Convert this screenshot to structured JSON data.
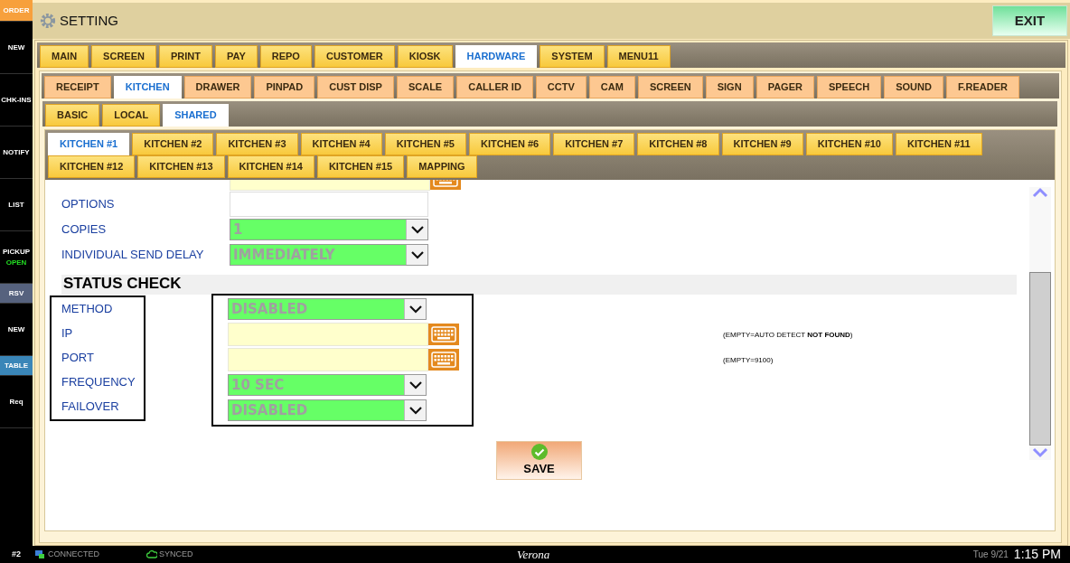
{
  "sidebar": {
    "items": [
      {
        "label": "ORDER",
        "color": "#f7a03c"
      },
      {
        "label": "NEW"
      },
      {
        "label": "CHK-INS"
      },
      {
        "label": "NOTIFY"
      },
      {
        "label": "LIST"
      },
      {
        "label": "PICKUP",
        "sub": "OPEN"
      },
      {
        "label": "RSV",
        "color": "#56627e"
      },
      {
        "label": "NEW"
      },
      {
        "label": "TABLE",
        "color": "#3a86b8"
      },
      {
        "label": "Req"
      }
    ]
  },
  "header": {
    "title": "SETTING",
    "exit": "EXIT"
  },
  "tabs": [
    {
      "label": "MAIN",
      "selected": false
    },
    {
      "label": "SCREEN",
      "selected": false
    },
    {
      "label": "PRINT",
      "selected": false
    },
    {
      "label": "PAY",
      "selected": false
    },
    {
      "label": "REPO",
      "selected": false
    },
    {
      "label": "CUSTOMER",
      "selected": false
    },
    {
      "label": "KIOSK",
      "selected": false
    },
    {
      "label": "HARDWARE",
      "selected": true
    },
    {
      "label": "SYSTEM",
      "selected": false
    },
    {
      "label": "MENU11",
      "selected": false
    }
  ],
  "hardware_tabs": [
    {
      "label": "RECEIPT",
      "selected": false
    },
    {
      "label": "KITCHEN",
      "selected": true
    },
    {
      "label": "DRAWER",
      "selected": false
    },
    {
      "label": "PINPAD",
      "selected": false
    },
    {
      "label": "CUST DISP",
      "selected": false
    },
    {
      "label": "SCALE",
      "selected": false
    },
    {
      "label": "CALLER ID",
      "selected": false
    },
    {
      "label": "CCTV",
      "selected": false
    },
    {
      "label": "CAM",
      "selected": false
    },
    {
      "label": "SCREEN",
      "selected": false
    },
    {
      "label": "SIGN",
      "selected": false
    },
    {
      "label": "PAGER",
      "selected": false
    },
    {
      "label": "SPEECH",
      "selected": false
    },
    {
      "label": "SOUND",
      "selected": false
    },
    {
      "label": "F.READER",
      "selected": false
    }
  ],
  "kitchen_tabs": [
    {
      "label": "BASIC",
      "selected": false
    },
    {
      "label": "LOCAL",
      "selected": false
    },
    {
      "label": "SHARED",
      "selected": true
    }
  ],
  "printer_tabs": [
    {
      "label": "KITCHEN #1",
      "selected": true
    },
    {
      "label": "KITCHEN #2",
      "selected": false
    },
    {
      "label": "KITCHEN #3",
      "selected": false
    },
    {
      "label": "KITCHEN #4",
      "selected": false
    },
    {
      "label": "KITCHEN #5",
      "selected": false
    },
    {
      "label": "KITCHEN #6",
      "selected": false
    },
    {
      "label": "KITCHEN #7",
      "selected": false
    },
    {
      "label": "KITCHEN #8",
      "selected": false
    },
    {
      "label": "KITCHEN #9",
      "selected": false
    },
    {
      "label": "KITCHEN #10",
      "selected": false
    },
    {
      "label": "KITCHEN #11",
      "selected": false
    },
    {
      "label": "KITCHEN #12",
      "selected": false
    },
    {
      "label": "KITCHEN #13",
      "selected": false
    },
    {
      "label": "KITCHEN #14",
      "selected": false
    },
    {
      "label": "KITCHEN #15",
      "selected": false
    },
    {
      "label": "MAPPING",
      "selected": false
    }
  ],
  "fields": [
    {
      "kind": "keyboard"
    },
    {
      "kind": "text",
      "label": "OPTIONS"
    },
    {
      "kind": "select",
      "label": "COPIES",
      "value": "1"
    },
    {
      "kind": "select",
      "label": "INDIVIDUAL SEND DELAY",
      "value": "IMMEDIATELY"
    }
  ],
  "status_check": {
    "title": "STATUS CHECK",
    "fields": [
      {
        "kind": "select",
        "label": "METHOD",
        "value": "DISABLED"
      },
      {
        "kind": "keyboard",
        "label": "IP",
        "hint": "(EMPTY=AUTO DETECT **NOT FOUND**)"
      },
      {
        "kind": "keyboard",
        "label": "PORT",
        "hint": "(EMPTY=9100)"
      },
      {
        "kind": "select",
        "label": "FREQUENCY",
        "value": "10 SEC"
      },
      {
        "kind": "select",
        "label": "FAILOVER",
        "value": "DISABLED"
      }
    ]
  },
  "save": "SAVE",
  "status_bar": {
    "station": "#2",
    "connection": "CONNECTED",
    "sync": "SYNCED",
    "store": "Verona",
    "date": "Tue 9/21",
    "time": "1:15 PM"
  }
}
